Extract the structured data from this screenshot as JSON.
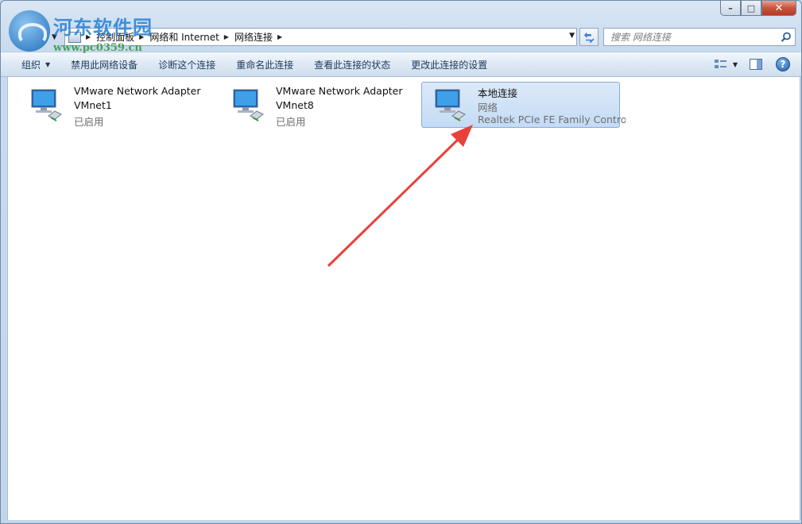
{
  "watermark": {
    "title": "河东软件园",
    "url": "www.pc0359.cn"
  },
  "window": {
    "buttons": {
      "minimize": "–",
      "maximize": "□",
      "close": "✕"
    }
  },
  "address": {
    "crumbs": [
      "控制面板",
      "网络和 Internet",
      "网络连接"
    ]
  },
  "search": {
    "placeholder": "搜索 网络连接"
  },
  "toolbar": {
    "organize_label": "组织",
    "commands": [
      "禁用此网络设备",
      "诊断这个连接",
      "重命名此连接",
      "查看此连接的状态",
      "更改此连接的设置"
    ]
  },
  "connections": [
    {
      "name": "VMware Network Adapter",
      "sub": "VMnet1",
      "status": "已启用",
      "selected": false
    },
    {
      "name": "VMware Network Adapter",
      "sub": "VMnet8",
      "status": "已启用",
      "selected": false
    },
    {
      "name": "本地连接",
      "sub": "网络",
      "status": "Realtek PCIe FE Family Control...",
      "selected": true
    }
  ],
  "colors": {
    "arrow": "#e8413a",
    "selection": "#c4dbf4"
  }
}
